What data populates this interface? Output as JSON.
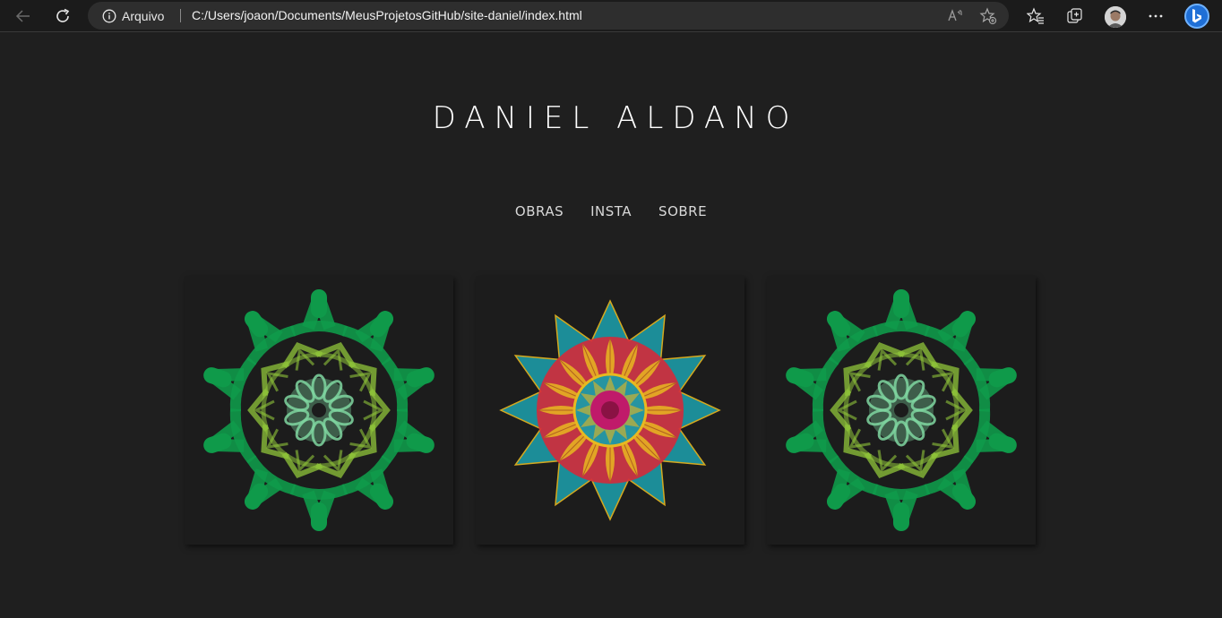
{
  "browser": {
    "site_info_label": "Arquivo",
    "url": "C:/Users/joaon/Documents/MeusProjetosGitHub/site-daniel/index.html"
  },
  "site": {
    "title": "DANIEL ALDANO",
    "nav": [
      "OBRAS",
      "INSTA",
      "SOBRE"
    ]
  },
  "gallery": [
    {
      "icon": "green-string-art-mandala",
      "palette": [
        "#0f9a4a",
        "#8fc43a",
        "#7fd6a0"
      ]
    },
    {
      "icon": "colorful-string-art-mandala",
      "palette": [
        "#1d9aa6",
        "#d42a3a",
        "#e8b820",
        "#c01a6a"
      ]
    },
    {
      "icon": "green-string-art-mandala",
      "palette": [
        "#0f9a4a",
        "#8fc43a",
        "#7fd6a0"
      ]
    }
  ]
}
